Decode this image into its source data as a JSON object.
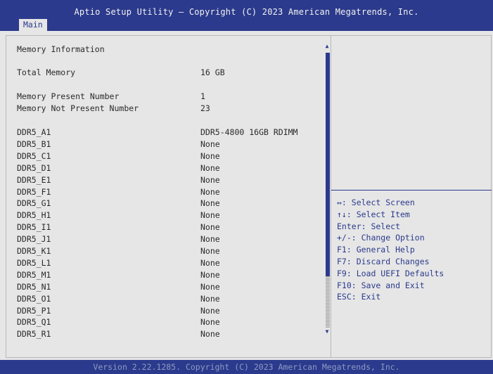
{
  "header": {
    "title": "Aptio Setup Utility – Copyright (C) 2023 American Megatrends, Inc.",
    "tab": "Main"
  },
  "memory": {
    "section_title": "Memory Information",
    "total_label": "Total Memory",
    "total_value": "16 GB",
    "present_label": "Memory Present Number",
    "present_value": "1",
    "not_present_label": "Memory Not Present Number",
    "not_present_value": "23",
    "slots": [
      {
        "name": "DDR5_A1",
        "value": "DDR5-4800 16GB RDIMM"
      },
      {
        "name": "DDR5_B1",
        "value": "None"
      },
      {
        "name": "DDR5_C1",
        "value": "None"
      },
      {
        "name": "DDR5_D1",
        "value": "None"
      },
      {
        "name": "DDR5_E1",
        "value": "None"
      },
      {
        "name": "DDR5_F1",
        "value": "None"
      },
      {
        "name": "DDR5_G1",
        "value": "None"
      },
      {
        "name": "DDR5_H1",
        "value": "None"
      },
      {
        "name": "DDR5_I1",
        "value": "None"
      },
      {
        "name": "DDR5_J1",
        "value": "None"
      },
      {
        "name": "DDR5_K1",
        "value": "None"
      },
      {
        "name": "DDR5_L1",
        "value": "None"
      },
      {
        "name": "DDR5_M1",
        "value": "None"
      },
      {
        "name": "DDR5_N1",
        "value": "None"
      },
      {
        "name": "DDR5_O1",
        "value": "None"
      },
      {
        "name": "DDR5_P1",
        "value": "None"
      },
      {
        "name": "DDR5_Q1",
        "value": "None"
      },
      {
        "name": "DDR5_R1",
        "value": "None"
      }
    ]
  },
  "help": [
    "↔: Select Screen",
    "↑↓: Select Item",
    "Enter: Select",
    "+/-: Change Option",
    "F1: General Help",
    "F7: Discard Changes",
    "F9: Load UEFI Defaults",
    "F10: Save and Exit",
    "ESC: Exit"
  ],
  "footer": "Version 2.22.1285. Copyright (C) 2023 American Megatrends, Inc.",
  "colors": {
    "accent": "#2b3a8c",
    "background": "#e6e6e6"
  }
}
